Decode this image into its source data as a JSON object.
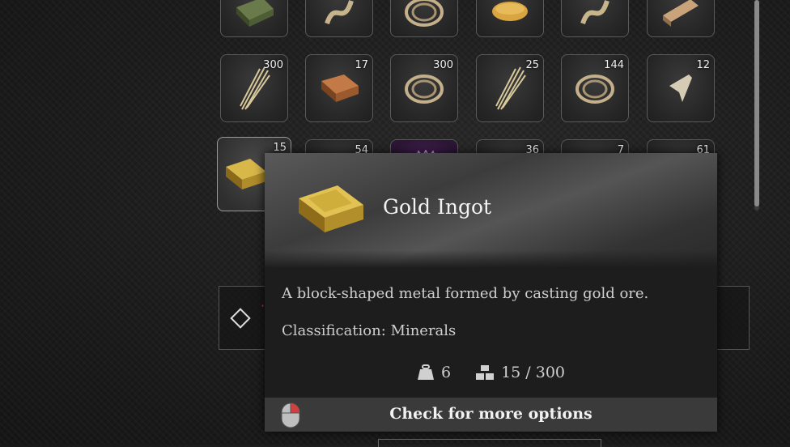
{
  "inventory": {
    "row1": [
      {
        "name": "copper-ore-icon",
        "qty": ""
      },
      {
        "name": "rope-icon",
        "qty": ""
      },
      {
        "name": "fiber-coil-icon",
        "qty": ""
      },
      {
        "name": "bread-icon",
        "qty": ""
      },
      {
        "name": "rope-icon",
        "qty": ""
      },
      {
        "name": "wood-plank-icon",
        "qty": ""
      }
    ],
    "row2": [
      {
        "name": "straw-bundle-icon",
        "qty": "300"
      },
      {
        "name": "copper-ingot-icon",
        "qty": "17"
      },
      {
        "name": "fiber-coil-icon",
        "qty": "300"
      },
      {
        "name": "straw-bundle-icon",
        "qty": "25"
      },
      {
        "name": "fiber-coil-icon",
        "qty": "144"
      },
      {
        "name": "fang-icon",
        "qty": "12"
      }
    ],
    "row3": [
      {
        "name": "gold-ingot-icon",
        "qty": "15"
      },
      {
        "name": "item-icon",
        "qty": "54"
      },
      {
        "name": "crown-icon",
        "qty": ""
      },
      {
        "name": "item-icon",
        "qty": "36"
      },
      {
        "name": "item-icon",
        "qty": "7"
      },
      {
        "name": "item-icon",
        "qty": "61"
      }
    ]
  },
  "tooltip": {
    "title": "Gold Ingot",
    "description": "A block-shaped metal formed by casting gold ore.",
    "classification": "Classification: Minerals",
    "weight": "6",
    "stack": "15 / 300",
    "footer": "Check for more options"
  },
  "colors": {
    "gold": "#c9a73a",
    "accent_red": "#d04040"
  }
}
